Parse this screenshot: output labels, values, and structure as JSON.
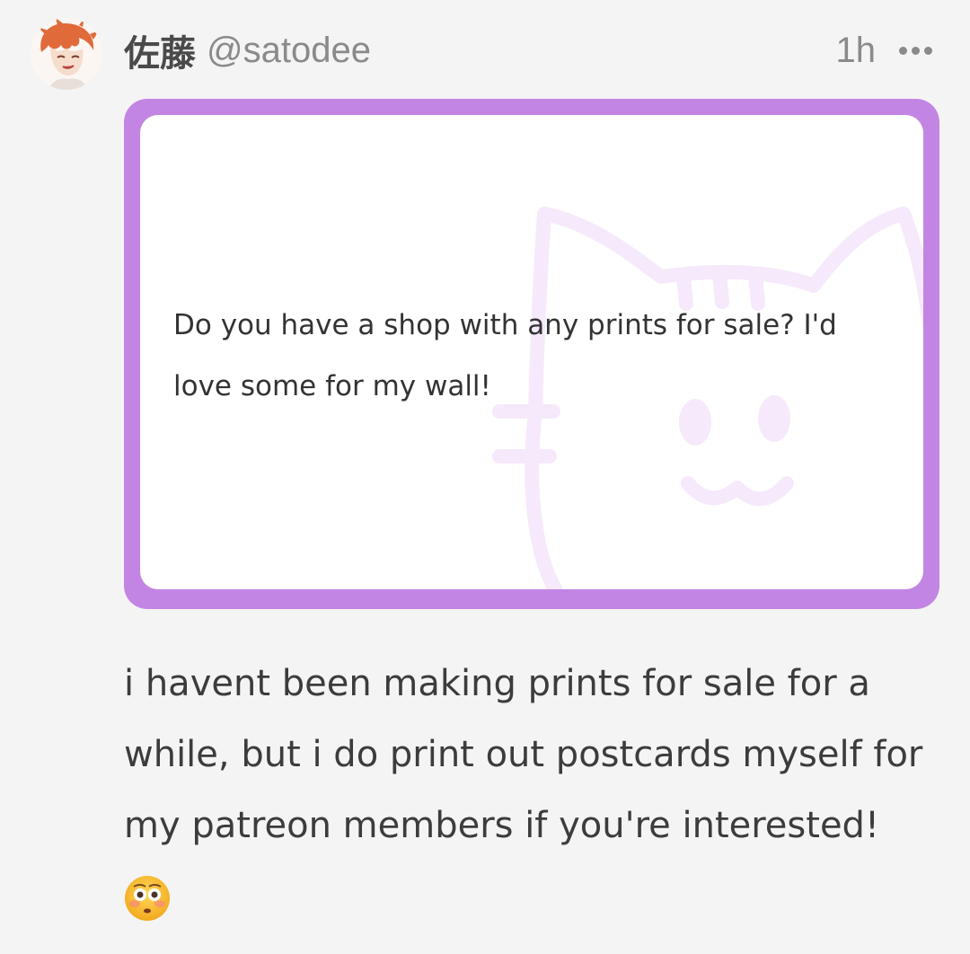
{
  "post": {
    "author": {
      "display_name": "佐藤",
      "handle": "@satodee"
    },
    "timestamp": "1h",
    "more_icon": "more-horizontal-icon",
    "ask": {
      "question": "Do you have a shop with any prints for sale? I'd love some for my wall!",
      "frame_color": "#c385e3"
    },
    "answer": "i havent been making prints for sale for a while, but i do print out postcards myself for my patreon members if you're interested!",
    "emoji": "flushed-face-emoji"
  }
}
